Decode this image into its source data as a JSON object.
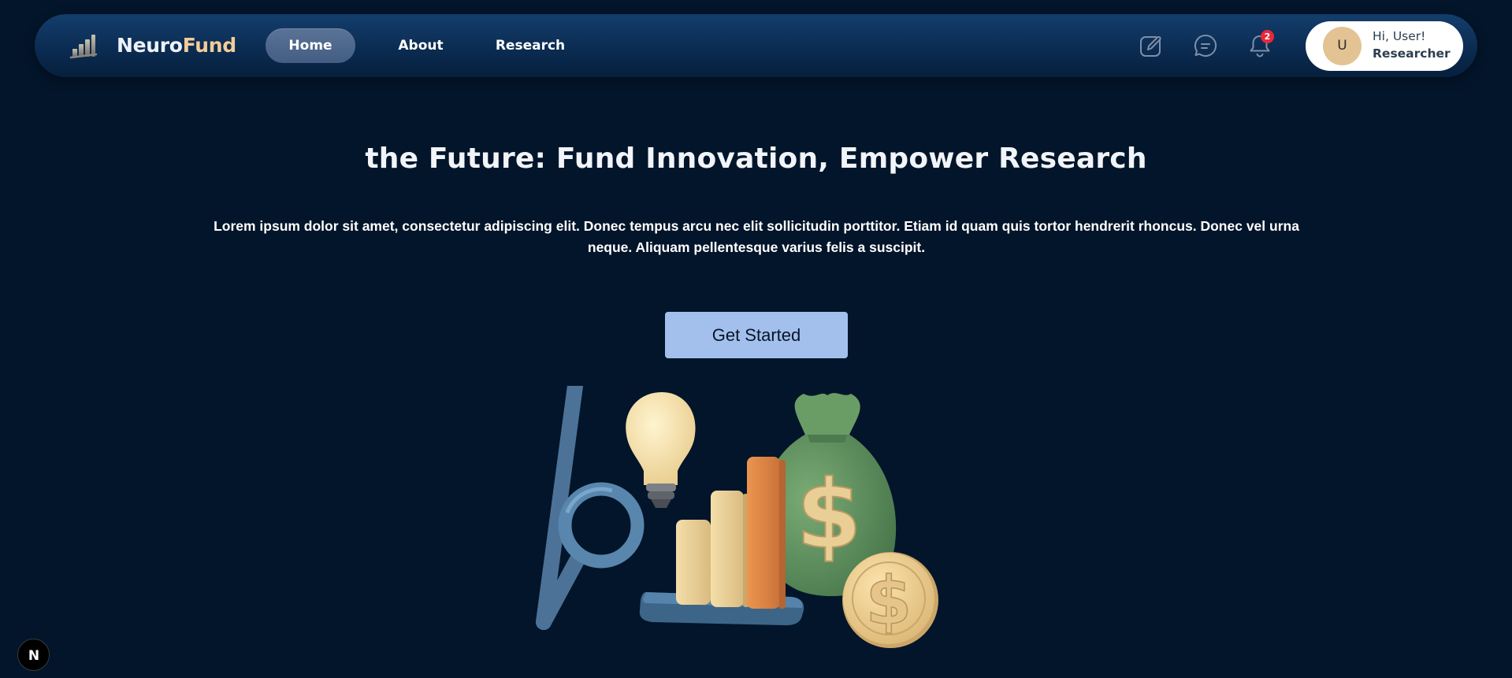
{
  "brand": {
    "part1": "Neuro",
    "part2": "Fund"
  },
  "nav": {
    "home": "Home",
    "about": "About",
    "research": "Research"
  },
  "toolbar": {
    "notifications_count": "2"
  },
  "user": {
    "avatar_initial": "U",
    "greeting": "Hi, User!",
    "role": "Researcher"
  },
  "hero": {
    "title": "the Future: Fund Innovation, Empower Research",
    "description": "Lorem ipsum dolor sit amet, consectetur adipiscing elit. Donec tempus arcu nec elit sollicitudin porttitor. Etiam id quam quis tortor hendrerit rhoncus. Donec vel urna neque. Aliquam pellentesque varius felis a suscipit.",
    "cta_label": "Get Started"
  },
  "dev_badge": {
    "letter": "N"
  },
  "colors": {
    "background": "#03152a",
    "nav_accent": "#133e6c",
    "brand_accent": "#f3cc98",
    "cta": "#a3c0ec",
    "badge": "#e8293a"
  },
  "icons": [
    "bar-chart-logo-icon",
    "edit-icon",
    "chat-icon",
    "bell-icon",
    "next-logo-icon"
  ]
}
